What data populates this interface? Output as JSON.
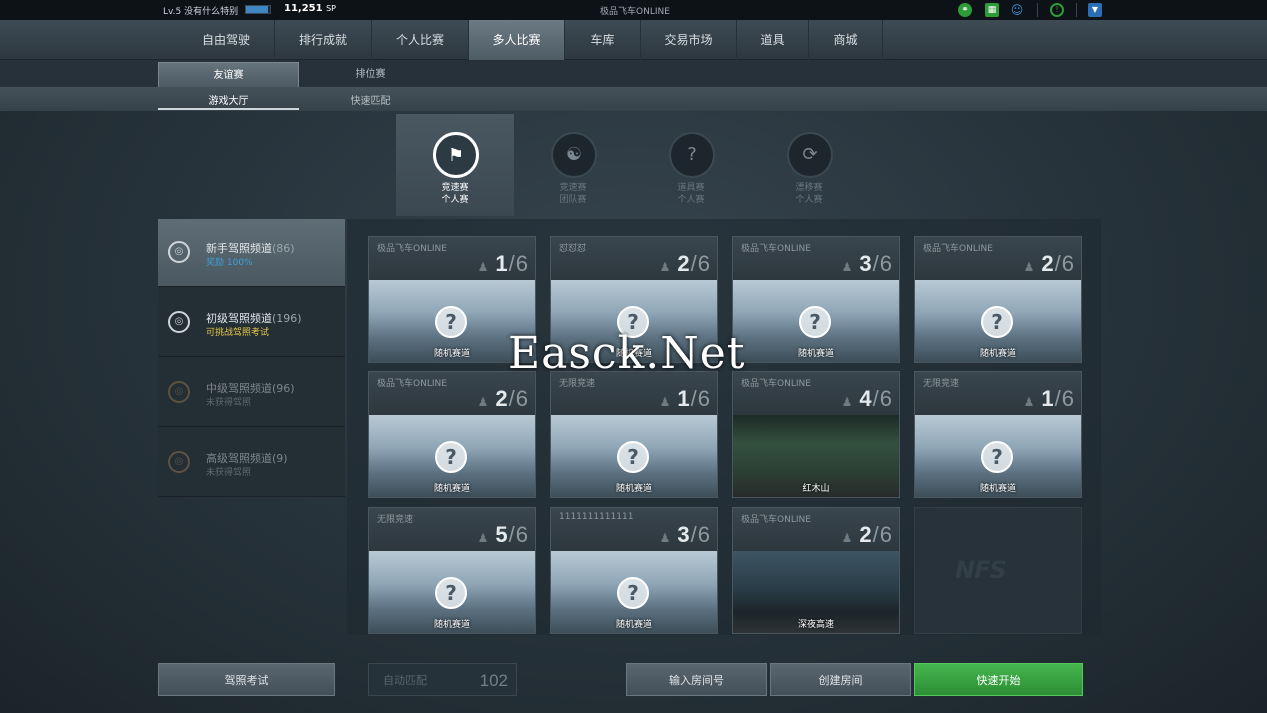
{
  "topbar": {
    "level": "Lv.5",
    "username": "没有什么特别",
    "xp_fraction": 0.9,
    "sp_value": "11,251",
    "sp_unit": "SP",
    "title": "极品飞车ONLINE",
    "icons": [
      "share-icon",
      "calendar-icon",
      "user-icon",
      "info-icon",
      "dropdown-icon"
    ]
  },
  "main_nav": {
    "items": [
      "自由驾驶",
      "排行成就",
      "个人比赛",
      "多人比赛",
      "车库",
      "交易市场",
      "道具",
      "商城"
    ],
    "active": "多人比赛"
  },
  "sub_nav": {
    "tabs": [
      "友谊赛",
      "排位赛"
    ],
    "active_tab": "友谊赛",
    "subtabs": [
      "游戏大厅",
      "快速匹配"
    ],
    "active_subtab": "游戏大厅"
  },
  "modes": [
    {
      "line1": "竞速赛",
      "line2": "个人赛",
      "icon": "checkered-flag-icon",
      "selected": true
    },
    {
      "line1": "竞速赛",
      "line2": "团队赛",
      "icon": "team-race-icon",
      "selected": false
    },
    {
      "line1": "道具赛",
      "line2": "个人赛",
      "icon": "item-race-icon",
      "selected": false
    },
    {
      "line1": "漂移赛",
      "line2": "个人赛",
      "icon": "drift-icon",
      "selected": false
    }
  ],
  "channels": [
    {
      "name": "新手驾照频道",
      "count": "(86)",
      "sub": "奖励 100%",
      "sub_color": "#3d9fd8",
      "selected": true,
      "locked": false
    },
    {
      "name": "初级驾照频道",
      "count": "(196)",
      "sub": "可挑战驾照考试",
      "sub_color": "#e6c64a",
      "selected": false,
      "locked": false
    },
    {
      "name": "中级驾照频道",
      "count": "(96)",
      "sub": "未获得驾照",
      "sub_color": "#5f686e",
      "selected": false,
      "locked": true
    },
    {
      "name": "高级驾照频道",
      "count": "(9)",
      "sub": "未获得驾照",
      "sub_color": "#5f686e",
      "selected": false,
      "locked": true
    }
  ],
  "rooms": [
    {
      "name": "极品飞车ONLINE",
      "players": "1",
      "max": "6",
      "track": "随机赛道",
      "image": "random"
    },
    {
      "name": "怼怼怼",
      "players": "2",
      "max": "6",
      "track": "随机赛道",
      "image": "random"
    },
    {
      "name": "极品飞车ONLINE",
      "players": "3",
      "max": "6",
      "track": "随机赛道",
      "image": "random"
    },
    {
      "name": "极品飞车ONLINE",
      "players": "2",
      "max": "6",
      "track": "随机赛道",
      "image": "random"
    },
    {
      "name": "极品飞车ONLINE",
      "players": "2",
      "max": "6",
      "track": "随机赛道",
      "image": "random"
    },
    {
      "name": "无限竞速",
      "players": "1",
      "max": "6",
      "track": "随机赛道",
      "image": "random"
    },
    {
      "name": "极品飞车ONLINE",
      "players": "4",
      "max": "6",
      "track": "红木山",
      "image": "forest"
    },
    {
      "name": "无限竞速",
      "players": "1",
      "max": "6",
      "track": "随机赛道",
      "image": "random"
    },
    {
      "name": "无限竞速",
      "players": "5",
      "max": "6",
      "track": "随机赛道",
      "image": "random"
    },
    {
      "name": "1111111111111",
      "players": "3",
      "max": "6",
      "track": "随机赛道",
      "image": "random"
    },
    {
      "name": "极品飞车ONLINE",
      "players": "2",
      "max": "6",
      "track": "深夜高速",
      "image": "night"
    }
  ],
  "empty_slot_logo": "NFS",
  "buttons": {
    "license_exam": "驾照考试",
    "auto_match": "自动匹配",
    "auto_match_count": "102",
    "enter_room_number": "输入房间号",
    "create_room": "创建房间",
    "quick_start": "快速开始"
  },
  "watermark": "Easck.Net"
}
